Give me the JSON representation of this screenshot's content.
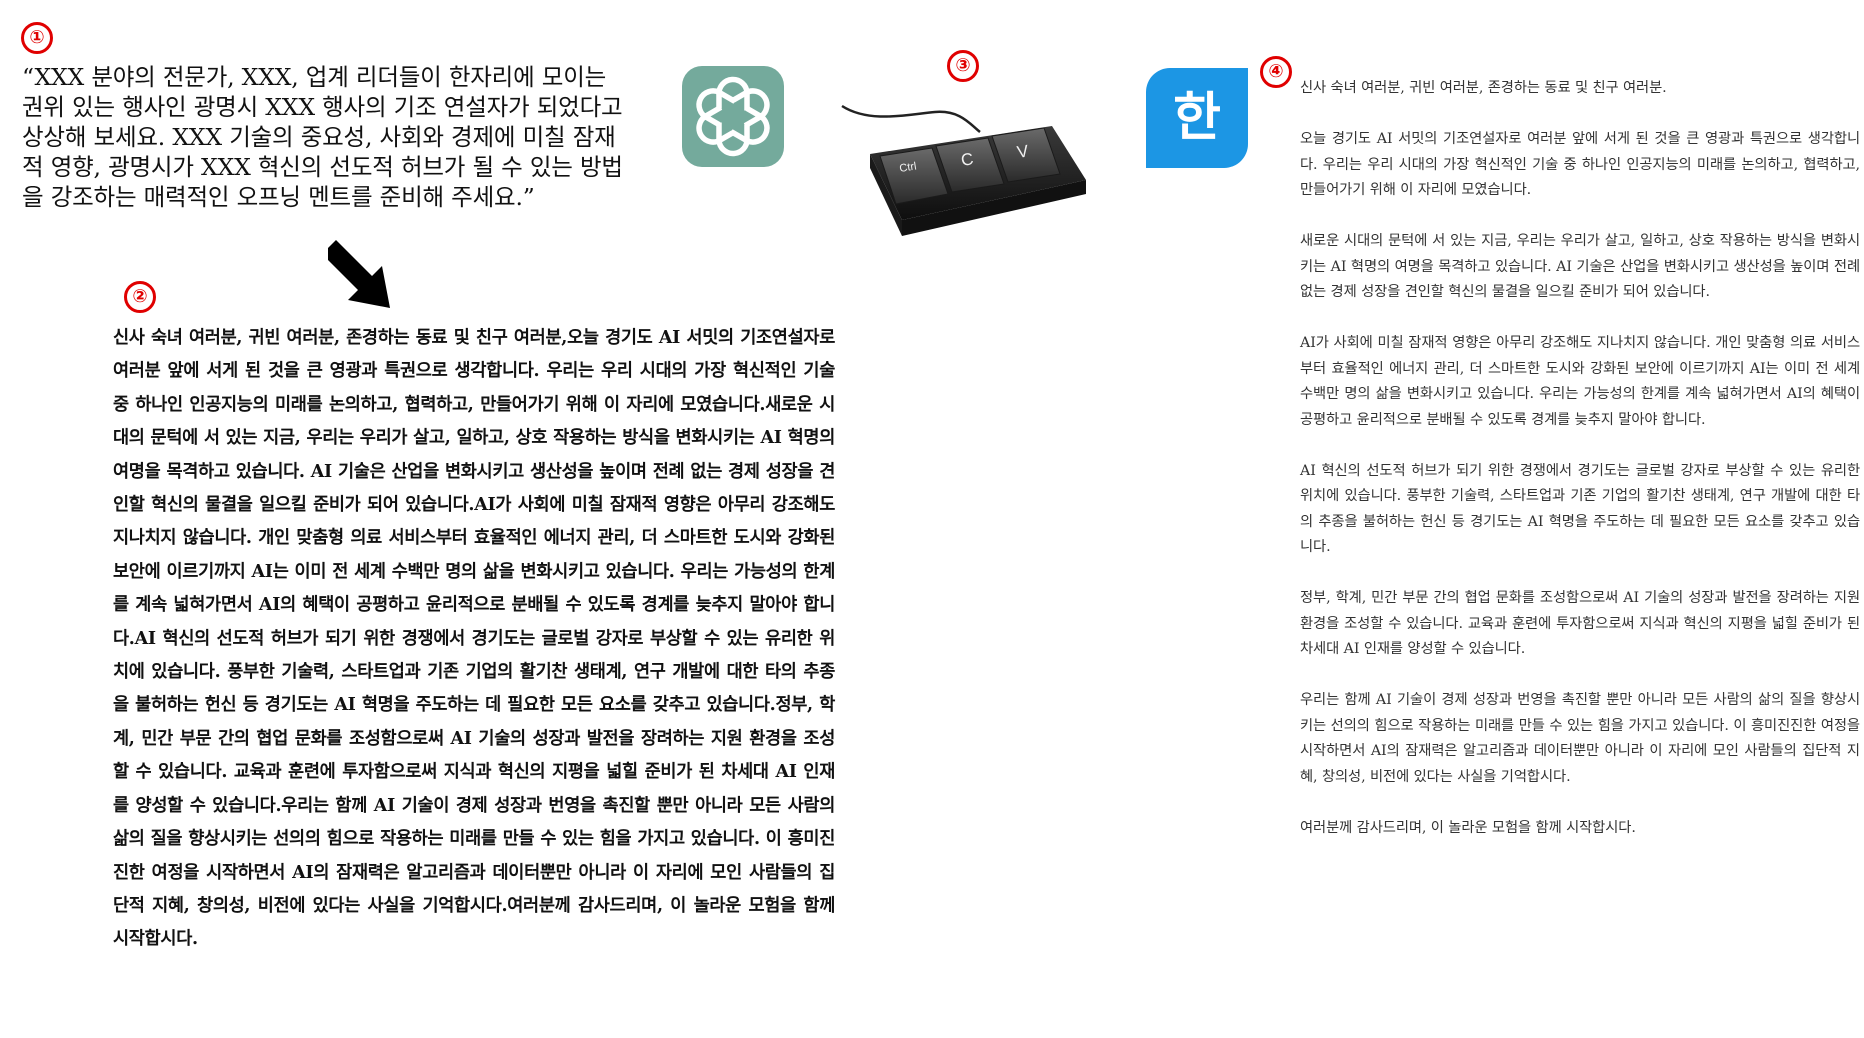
{
  "markers": [
    "①",
    "②",
    "③",
    "④"
  ],
  "prompt_text": "“XXX 분야의 전문가, XXX, 업계 리더들이 한자리에 모이는 권위 있는 행사인 광명시 XXX 행사의 기조 연설자가 되었다고 상상해 보세요. XXX 기술의 중요성, 사회와 경제에 미칠 잠재적 영향, 광명시가 XXX 혁신의 선도적 허브가 될 수 있는 방법을 강조하는 매력적인 오프닝 멘트를 준비해 주세요.”",
  "chatgpt_response": "신사 숙녀 여러분, 귀빈 여러분, 존경하는 동료 및 친구 여러분,오늘 경기도 AI 서밋의 기조연설자로 여러분 앞에 서게 된 것을 큰 영광과 특권으로 생각합니다. 우리는 우리 시대의 가장 혁신적인 기술 중 하나인 인공지능의 미래를 논의하고, 협력하고, 만들어가기 위해 이 자리에 모였습니다.새로운 시대의 문턱에 서 있는 지금, 우리는 우리가 살고, 일하고, 상호 작용하는 방식을 변화시키는 AI 혁명의 여명을 목격하고 있습니다. AI 기술은 산업을 변화시키고 생산성을 높이며 전례 없는 경제 성장을 견인할 혁신의 물결을 일으킬 준비가 되어 있습니다.AI가 사회에 미칠 잠재적 영향은 아무리 강조해도 지나치지 않습니다. 개인 맞춤형 의료 서비스부터 효율적인 에너지 관리, 더 스마트한 도시와 강화된 보안에 이르기까지 AI는 이미 전 세계 수백만 명의 삶을 변화시키고 있습니다. 우리는 가능성의 한계를 계속 넓혀가면서 AI의 혜택이 공평하고 윤리적으로 분배될 수 있도록 경계를 늦추지 말아야 합니다.AI 혁신의 선도적 허브가 되기 위한 경쟁에서 경기도는 글로벌 강자로 부상할 수 있는 유리한 위치에 있습니다. 풍부한 기술력, 스타트업과 기존 기업의 활기찬 생태계, 연구 개발에 대한 타의 추종을 불허하는 헌신 등 경기도는 AI 혁명을 주도하는 데 필요한 모든 요소를 갖추고 있습니다.정부, 학계, 민간 부문 간의 협업 문화를 조성함으로써 AI 기술의 성장과 발전을 장려하는 지원 환경을 조성할 수 있습니다. 교육과 훈련에 투자함으로써 지식과 혁신의 지평을 넓힐 준비가 된 차세대 AI 인재를 양성할 수 있습니다.우리는 함께 AI 기술이 경제 성장과 번영을 촉진할 뿐만 아니라 모든 사람의 삶의 질을 향상시키는 선의의 힘으로 작용하는 미래를 만들 수 있는 힘을 가지고 있습니다. 이 흥미진진한 여정을 시작하면서 AI의 잠재력은 알고리즘과 데이터뿐만 아니라 이 자리에 모인 사람들의 집단적 지혜, 창의성, 비전에 있다는 사실을 기억합시다.여러분께 감사드리며, 이 놀라운 모험을 함께 시작합시다.",
  "keyboard_keys": [
    "Ctrl",
    "C",
    "V"
  ],
  "hangul_logo_char": "한",
  "pasted_paragraphs": [
    "신사 숙녀 여러분, 귀빈 여러분, 존경하는 동료 및 친구 여러분.",
    "오늘 경기도 AI 서밋의 기조연설자로 여러분 앞에 서게 된 것을 큰 영광과 특권으로 생각합니다. 우리는 우리 시대의 가장 혁신적인 기술 중 하나인 인공지능의 미래를 논의하고, 협력하고, 만들어가기 위해 이 자리에 모였습니다.",
    "새로운 시대의 문턱에 서 있는 지금, 우리는 우리가 살고, 일하고, 상호 작용하는 방식을 변화시키는 AI 혁명의 여명을 목격하고 있습니다. AI 기술은 산업을 변화시키고 생산성을 높이며 전례 없는 경제 성장을 견인할 혁신의 물결을 일으킬 준비가 되어 있습니다.",
    "AI가 사회에 미칠 잠재적 영향은 아무리 강조해도 지나치지 않습니다. 개인 맞춤형 의료 서비스부터 효율적인 에너지 관리, 더 스마트한 도시와 강화된 보안에 이르기까지 AI는 이미 전 세계 수백만 명의 삶을 변화시키고 있습니다. 우리는 가능성의 한계를 계속 넓혀가면서 AI의 혜택이 공평하고 윤리적으로 분배될 수 있도록 경계를 늦추지 말아야 합니다.",
    "AI 혁신의 선도적 허브가 되기 위한 경쟁에서 경기도는 글로벌 강자로 부상할 수 있는 유리한 위치에 있습니다. 풍부한 기술력, 스타트업과 기존 기업의 활기찬 생태계, 연구 개발에 대한 타의 추종을 불허하는 헌신 등 경기도는 AI 혁명을 주도하는 데 필요한 모든 요소를 갖추고 있습니다.",
    "정부, 학계, 민간 부문 간의 협업 문화를 조성함으로써 AI 기술의 성장과 발전을 장려하는 지원 환경을 조성할 수 있습니다. 교육과 훈련에 투자함으로써 지식과 혁신의 지평을 넓힐 준비가 된 차세대 AI 인재를 양성할 수 있습니다.",
    "우리는 함께 AI 기술이 경제 성장과 번영을 촉진할 뿐만 아니라 모든 사람의 삶의 질을 향상시키는 선의의 힘으로 작용하는 미래를 만들 수 있는 힘을 가지고 있습니다. 이 흥미진진한 여정을 시작하면서 AI의 잠재력은 알고리즘과 데이터뿐만 아니라 이 자리에 모인 사람들의 집단적 지혜, 창의성, 비전에 있다는 사실을 기억합시다.",
    "여러분께 감사드리며, 이 놀라운 모험을 함께 시작합시다."
  ],
  "icons": [
    "chatgpt-logo-icon",
    "keyboard-ctrl-c-v-icon",
    "hancom-hangul-logo-icon",
    "down-arrow-icon"
  ],
  "colors": {
    "marker_red": "#e00000",
    "chatgpt_green": "#74aa9c",
    "hangul_blue": "#1c96e4",
    "doc_text": "#333333"
  }
}
